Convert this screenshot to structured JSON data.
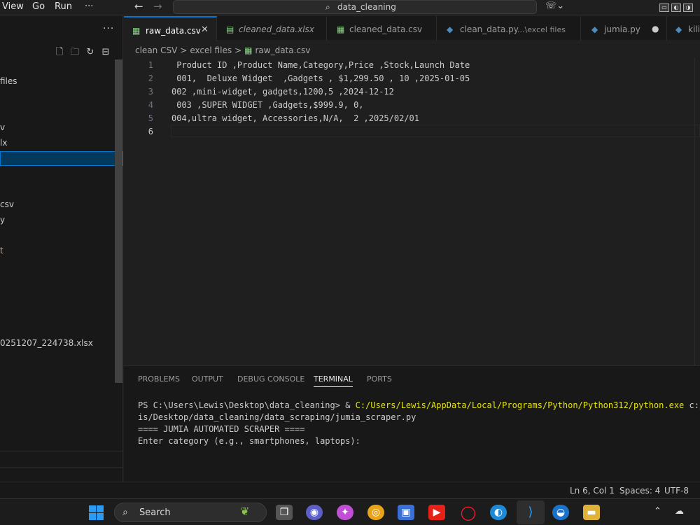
{
  "menu": {
    "view": "View",
    "go": "Go",
    "run": "Run",
    "more": "···"
  },
  "title_search": {
    "text": "data_cleaning"
  },
  "title_extra": {
    "copilot": "⌄"
  },
  "sidebar": {
    "more": "···",
    "items": [
      {
        "label": "files"
      },
      {
        "label": "v"
      },
      {
        "label": "lx"
      },
      {
        "label": ""
      },
      {
        "label": "csv"
      },
      {
        "label": "y"
      },
      {
        "label": "t"
      },
      {
        "label": "0251207_224738.xlsx"
      }
    ]
  },
  "tabs": [
    {
      "label": "raw_data.csv",
      "close": "✕"
    },
    {
      "label": "cleaned_data.xlsx"
    },
    {
      "label": "cleaned_data.csv"
    },
    {
      "label": "clean_data.py",
      "desc": "...\\excel files"
    },
    {
      "label": "jumia.py",
      "dot": "●"
    },
    {
      "label": "kili"
    }
  ],
  "breadcrumb": {
    "p1": "clean CSV",
    "p2": "excel files",
    "p3": "raw_data.csv",
    "sep": ">"
  },
  "editor": {
    "lines": [
      {
        "num": "1",
        "text": " Product ID ,Product Name,Category,Price ,Stock,Launch Date"
      },
      {
        "num": "2",
        "text": " 001,  Deluxe Widget  ,Gadgets , $1,299.50 , 10 ,2025-01-05"
      },
      {
        "num": "3",
        "text": "002 ,mini-widget, gadgets,1200,5 ,2024-12-12"
      },
      {
        "num": "4",
        "text": " 003 ,SUPER WIDGET ,Gadgets,$999.9, 0,"
      },
      {
        "num": "5",
        "text": "004,ultra widget, Accessories,N/A,  2 ,2025/02/01"
      },
      {
        "num": "6",
        "text": ""
      }
    ]
  },
  "panel": {
    "tabs": [
      "PROBLEMS",
      "OUTPUT",
      "DEBUG CONSOLE",
      "TERMINAL",
      "PORTS"
    ],
    "terminal": {
      "prompt": "PS C:\\Users\\Lewis\\Desktop\\data_cleaning> & ",
      "exe": "C:/Users/Lewis/AppData/Local/Programs/Python/Python312/python.exe",
      "arg": " c:/Use",
      "line2": "is/Desktop/data_cleaning/data_scraping/jumia_scraper.py",
      "line3": "==== JUMIA AUTOMATED SCRAPER ====",
      "line4": "Enter category (e.g., smartphones, laptops):"
    }
  },
  "status": {
    "position": "Ln 6, Col 1",
    "spaces": "Spaces: 4",
    "encoding": "UTF-8"
  },
  "taskbar": {
    "search": "Search"
  },
  "colors": {
    "accent": "#0078d4",
    "terminal_yellow": "#e5e510",
    "selection": "#04395e"
  }
}
